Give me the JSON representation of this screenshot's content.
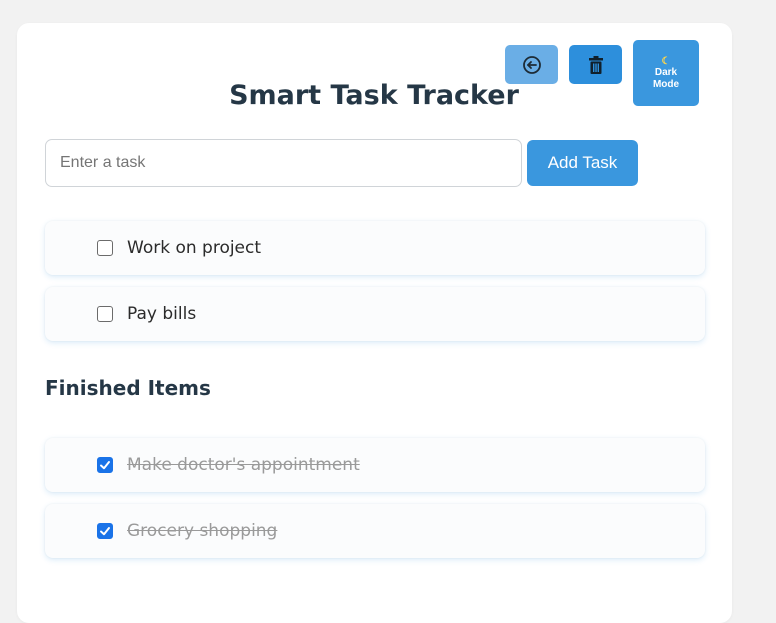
{
  "app": {
    "title": "Smart Task Tracker"
  },
  "toolbar": {
    "undo_icon": "undo-circle-arrow-icon",
    "clear_icon": "trash-icon",
    "dark_mode_icon": "moon-icon",
    "dark_mode_label_line1": "Dark",
    "dark_mode_label_line2": "Mode"
  },
  "input": {
    "placeholder": "Enter a task",
    "value": ""
  },
  "add_button": {
    "label": "Add Task"
  },
  "tasks": [
    {
      "label": "Work on project",
      "checked": false
    },
    {
      "label": "Pay bills",
      "checked": false
    }
  ],
  "finished": {
    "heading": "Finished Items",
    "items": [
      {
        "label": "Make doctor's appointment",
        "checked": true
      },
      {
        "label": "Grocery shopping",
        "checked": true
      }
    ]
  },
  "colors": {
    "primary": "#3a97de",
    "primary_light": "#6aaee6",
    "heading": "#253746",
    "checked": "#1a73e8"
  }
}
